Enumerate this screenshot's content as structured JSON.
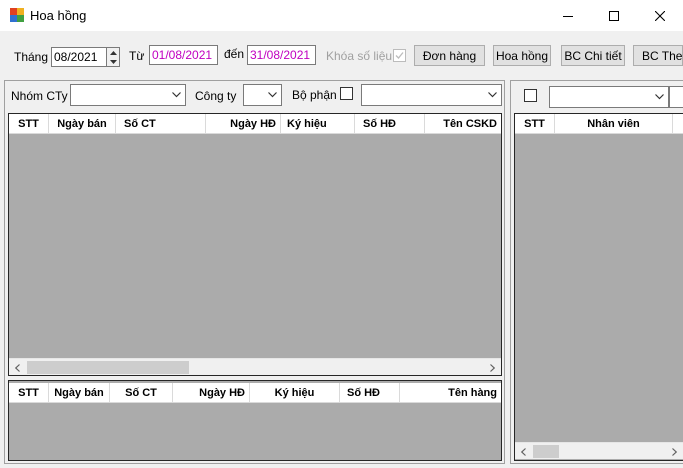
{
  "window": {
    "title": "Hoa hồng"
  },
  "toolbar": {
    "month_label": "Tháng",
    "month_value": "08/2021",
    "from_label": "Từ",
    "from_value": "01/08/2021",
    "to_label": "đến",
    "to_value": "31/08/2021",
    "lock_label": "Khóa số liệu",
    "buttons": [
      "Đơn hàng",
      "Hoa hồng",
      "BC Chi tiết",
      "BC Theo"
    ]
  },
  "filters": {
    "group_label": "Nhóm CTy",
    "company_label": "Công ty",
    "department_label": "Bộ phận"
  },
  "grid_top": {
    "columns": [
      "STT",
      "Ngày bán",
      "Số CT",
      "Ngày HĐ",
      "Ký hiệu",
      "Số HĐ",
      "Tên CSKD"
    ]
  },
  "grid_bottom": {
    "columns": [
      "STT",
      "Ngày bán",
      "Số CT",
      "Ngày HĐ",
      "Ký hiệu",
      "Số HĐ",
      "Tên hàng"
    ]
  },
  "grid_right": {
    "columns": [
      "STT",
      "Nhân viên"
    ]
  },
  "colors": {
    "date_text": "#c000c0",
    "grid_bg": "#ababab"
  }
}
